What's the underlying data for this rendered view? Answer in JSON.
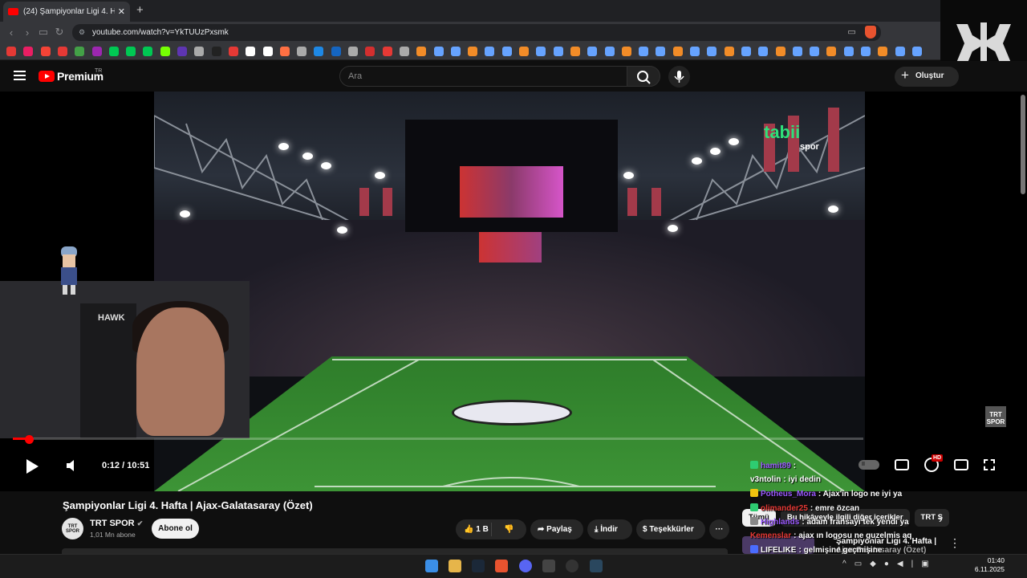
{
  "browser": {
    "tab_title": "(24) Şampiyonlar Ligi 4. Hafta | Aja",
    "tab_close": "✕",
    "new_tab": "+",
    "url": "youtube.com/watch?v=YkTUUzPxsmk",
    "brave_badge": "10",
    "extension_badge": "12"
  },
  "youtube": {
    "brand": "Premium",
    "region": "TR",
    "search_placeholder": "Ara",
    "create_label": "Oluştur"
  },
  "video": {
    "tabii_logo": "tabii",
    "tabii_sub": "spor",
    "trt_bug": "TRT SPOR",
    "webcam_chair_brand": "HAWK",
    "progress_fraction": 0.019,
    "time_current": "0:12",
    "time_separator": " / ",
    "time_total": "10:51",
    "hd_badge": "HD",
    "autoplay_badge": "II"
  },
  "meta": {
    "title": "Şampiyonlar Ligi 4. Hafta | Ajax-Galatasaray (Özet)",
    "channel": "TRT SPOR",
    "channel_logo": "TRT SPOR",
    "subscribers": "1,01 Mn abone",
    "subscribe": "Abone ol",
    "likes": "1 B",
    "share": "Paylaş",
    "download": "İndir",
    "thanks": "Teşekkürler",
    "more": "···"
  },
  "chat": [
    {
      "user": "hamit89",
      "msg": "",
      "color": "#9b59ff",
      "badge": "#2ecc71"
    },
    {
      "user": "v3ntolin",
      "msg": "iyi dedin",
      "color": "#ffffff",
      "badge": ""
    },
    {
      "user": "Potheus_Mora",
      "msg": "Ajax'ın logo ne iyi ya",
      "color": "#9b59ff",
      "badge": "#f1c40f"
    },
    {
      "user": "olimander25",
      "msg": "emre özcan",
      "color": "#e53935",
      "badge": "#2ecc71"
    },
    {
      "user": "Highlands",
      "msg": "adam fransayı tek yendi ya",
      "color": "#9b59ff",
      "badge": "#888888"
    },
    {
      "user": "Kemenslar",
      "msg": "ajax ın logosu ne guzelmis aq",
      "color": "#e53935",
      "badge": ""
    },
    {
      "user": "LIFELIKE",
      "msg": "gelmişine geçmişine",
      "color": "#ffffff",
      "badge": "#4a6cff"
    }
  ],
  "chips": [
    "Tümü",
    "Bu hikâyeyle ilgili diğer içerikler",
    "TRT S"
  ],
  "recommendation": {
    "title": "Şampiyonlar Ligi 4. Hafta |",
    "subtitle": "Ajax-Galatasaray (Özet)",
    "more": "⋮"
  },
  "taskbar": {
    "time": "01:40",
    "date": "6.11.2025"
  },
  "colors": {
    "accent": "#ff0000",
    "tabii": "#2fe07a",
    "background": "#0f0f0f"
  }
}
